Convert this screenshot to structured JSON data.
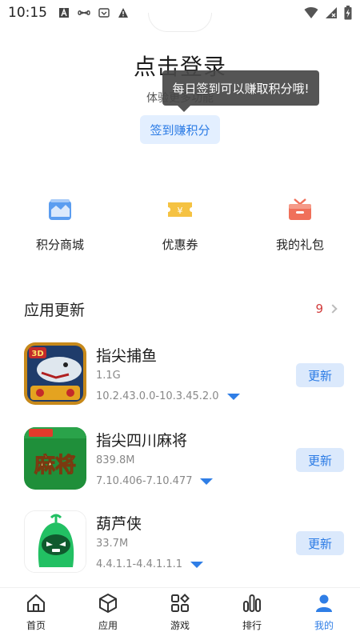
{
  "status_bar": {
    "time": "10:15"
  },
  "profile": {
    "title": "点击登录",
    "subtitle": "体验更多功能",
    "checkin_label": "签到赚积分",
    "tooltip": "每日签到可以赚取积分哦!"
  },
  "quick_actions": [
    {
      "label": "积分商城",
      "icon": "points-mall-icon"
    },
    {
      "label": "优惠券",
      "icon": "coupon-icon"
    },
    {
      "label": "我的礼包",
      "icon": "gift-box-icon"
    }
  ],
  "updates": {
    "title": "应用更新",
    "count": "9",
    "items": [
      {
        "name": "指尖捕鱼",
        "size": "1.1G",
        "version": "10.2.43.0.0-10.3.45.2.0",
        "button": "更新"
      },
      {
        "name": "指尖四川麻将",
        "size": "839.8M",
        "version": "7.10.406-7.10.477",
        "button": "更新"
      },
      {
        "name": "葫芦侠",
        "size": "33.7M",
        "version": "4.4.1.1-4.4.1.1.1",
        "button": "更新"
      }
    ]
  },
  "nav": [
    {
      "label": "首页",
      "icon": "home-icon"
    },
    {
      "label": "应用",
      "icon": "app-box-icon"
    },
    {
      "label": "游戏",
      "icon": "game-grid-icon"
    },
    {
      "label": "排行",
      "icon": "ranking-bars-icon"
    },
    {
      "label": "我的",
      "icon": "person-icon",
      "active": true
    }
  ],
  "colors": {
    "accent": "#2f7ee6",
    "badge_red": "#d23c3c",
    "button_bg": "#dbe9fc"
  },
  "app_icon_text": {
    "fish_badge": "3D",
    "mahjong_text": "麻将"
  }
}
